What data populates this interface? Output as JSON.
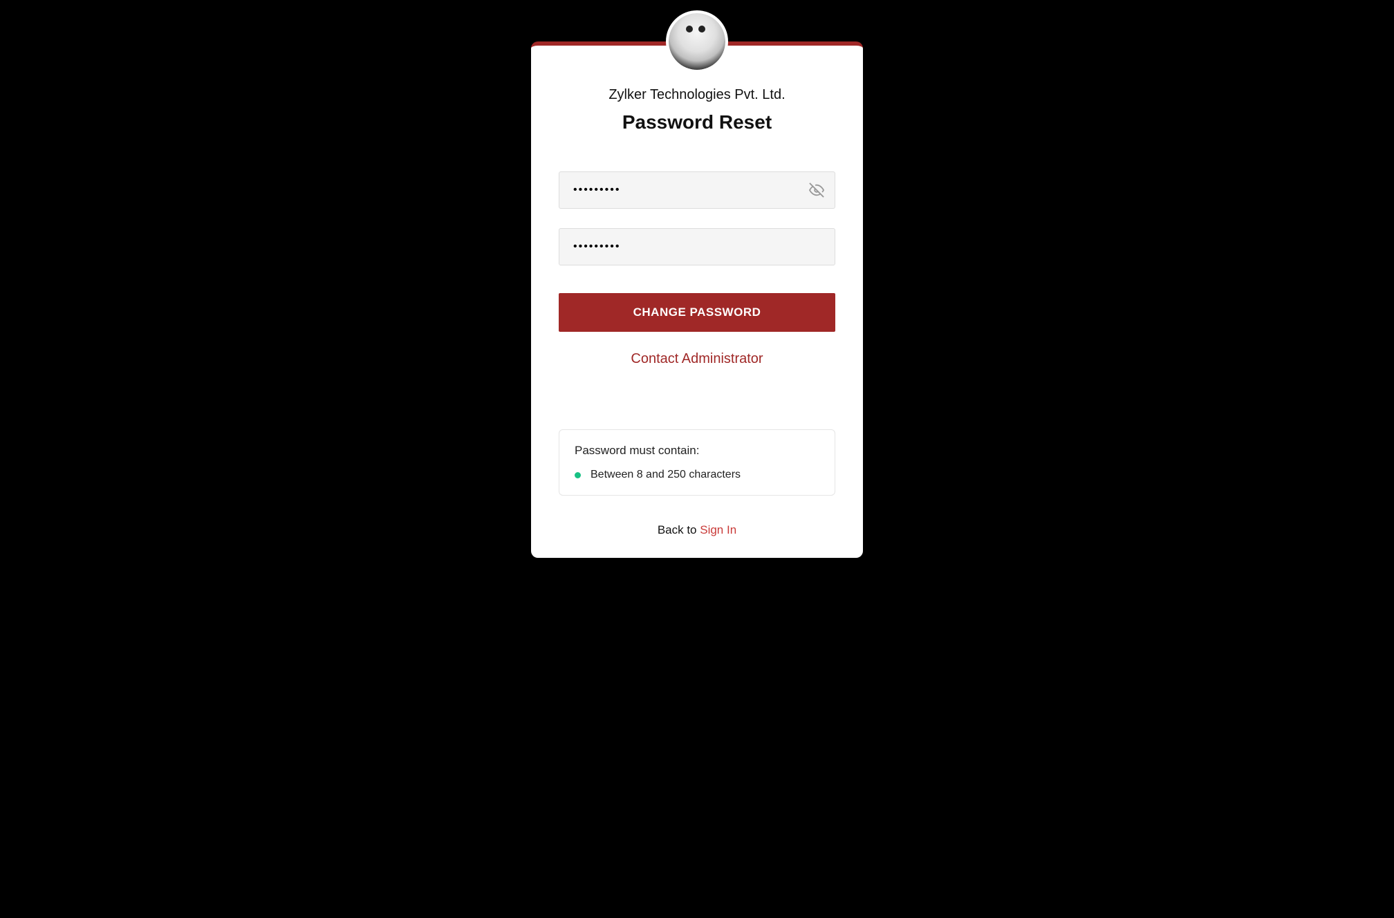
{
  "company": "Zylker Technologies Pvt. Ltd.",
  "title": "Password Reset",
  "form": {
    "new_password_value": "•••••••••",
    "confirm_password_value": "•••••••••",
    "submit_label": "CHANGE PASSWORD"
  },
  "links": {
    "contact_admin": "Contact Administrator",
    "back_prefix": "Back to ",
    "signin": "Sign In"
  },
  "requirements": {
    "title": "Password must contain:",
    "items": [
      "Between 8 and 250 characters"
    ]
  },
  "icons": {
    "eye_hidden": "eye-hidden-icon"
  },
  "colors": {
    "accent": "#a02827",
    "success": "#18c184"
  }
}
